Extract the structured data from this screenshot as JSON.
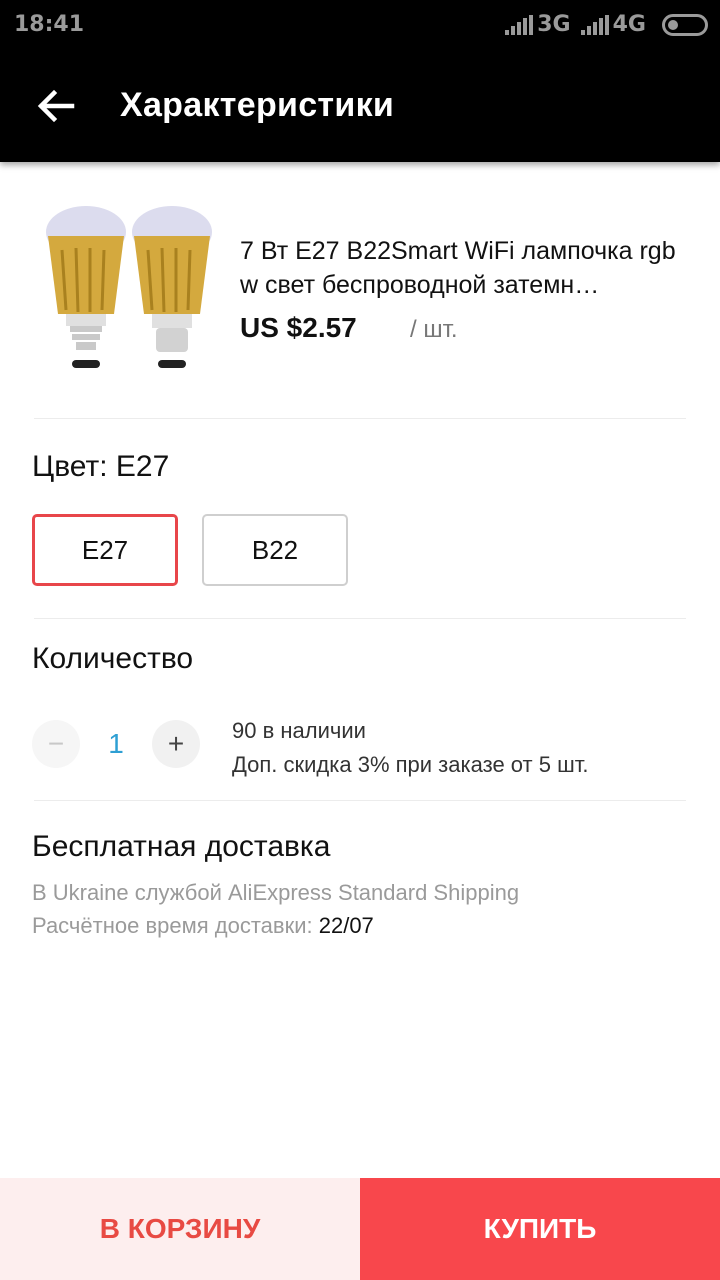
{
  "status_bar": {
    "time": "18:41",
    "network_1": "3G",
    "network_2": "4G"
  },
  "header": {
    "title": "Характеристики",
    "back_icon": "arrow-left-icon"
  },
  "product": {
    "title": "7 Вт E27 B22Smart WiFi лампочка rgbw свет беспроводной затемн…",
    "price": "US $2.57",
    "unit": "/ шт.",
    "image_icon": "bulbs-image"
  },
  "color": {
    "label": "Цвет: E27",
    "options": [
      "E27",
      "B22"
    ],
    "selected": "E27",
    "selected_border_color": "#e8464a"
  },
  "quantity": {
    "label": "Количество",
    "value": "1",
    "minus": "−",
    "plus": "+",
    "stock": "90 в наличии",
    "discount": "Доп. скидка 3% при заказе от 5 шт."
  },
  "shipping": {
    "title": "Бесплатная доставка",
    "method": "В Ukraine службой AliExpress Standard Shipping",
    "eta_label": "Расчётное время доставки:",
    "eta_date": "22/07"
  },
  "actions": {
    "cart": "В КОРЗИНУ",
    "buy": "КУПИТЬ",
    "accent_color": "#f8474c"
  }
}
